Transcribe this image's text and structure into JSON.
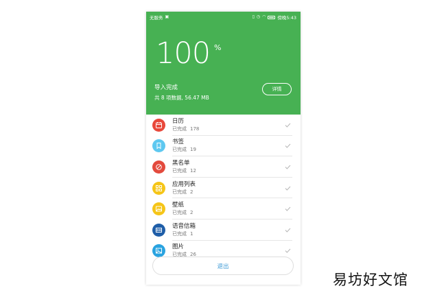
{
  "status_bar": {
    "carrier": "无服务",
    "time": "傍晚5:43"
  },
  "header": {
    "percent_value": "100",
    "percent_sign": "%",
    "progress_percent": 100,
    "import_status": "导入完成",
    "import_summary": "共 8 项数据, 56.47 MB",
    "details_label": "详情"
  },
  "items": [
    {
      "title": "日历",
      "status": "已完成",
      "count": "178",
      "color": "#e8483b",
      "icon": "calendar-icon"
    },
    {
      "title": "书签",
      "status": "已完成",
      "count": "19",
      "color": "#5ec8f0",
      "icon": "bookmark-icon"
    },
    {
      "title": "黑名单",
      "status": "已完成",
      "count": "12",
      "color": "#e34a3d",
      "icon": "block-icon"
    },
    {
      "title": "应用列表",
      "status": "已完成",
      "count": "2",
      "color": "#f5c518",
      "icon": "apps-grid-icon"
    },
    {
      "title": "壁纸",
      "status": "已完成",
      "count": "2",
      "color": "#f5c518",
      "icon": "wallpaper-icon"
    },
    {
      "title": "语音信箱",
      "status": "已完成",
      "count": "1",
      "color": "#1f5ea8",
      "icon": "voicemail-icon"
    },
    {
      "title": "图片",
      "status": "已完成",
      "count": "26",
      "color": "#2aa3e0",
      "icon": "image-icon"
    }
  ],
  "exit_label": "退出",
  "watermark": "易坊好文馆"
}
